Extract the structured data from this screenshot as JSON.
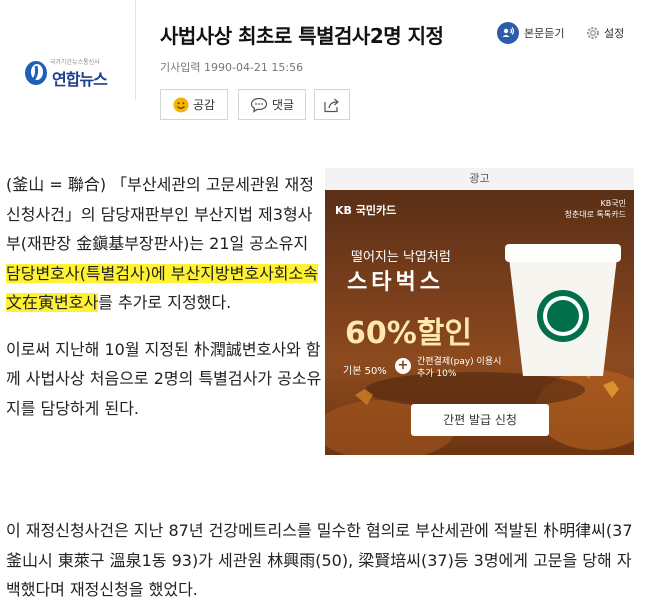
{
  "brand": {
    "logo_small": "국가기간뉴스통신사",
    "logo_text": "연합뉴스"
  },
  "article": {
    "title": "사법사상 최초로 특별검사2명 지정",
    "dateline": "기사입력 1990-04-21 15:56",
    "paragraphs": [
      {
        "pre": "(釜山 = 聯合) 「부산세관의 고문세관원 재정신청사건」의 담당재판부인 부산지법 제3형사부(재판장 金鎭基부장판사)는 21일 공소유지 ",
        "highlight": "담당변호사(특별검사)에 부산지방변호사회소속 文在寅변호사",
        "post": "를 추가로 지정했다."
      },
      {
        "text": "이로써 지난해 10월 지정된 朴潤誠변호사와 함께 사법사상 처음으로 2명의 특별검사가 공소유지를 담당하게 된다."
      },
      {
        "text": "이 재정신청사건은 지난 87년 건강메트리스를 밀수한 혐의로 부산세관에 적발된 朴明律씨(37 釜山시 東萊구 溫泉1동 93)가 세관원 林興雨(50), 梁賢培씨(37)등 3명에게 고문을 당해 자백했다며 재정신청을 했었다."
      }
    ]
  },
  "toolbar": {
    "listen_label": "본문듣기",
    "settings_label": "설정",
    "like_label": "공감",
    "comment_label": "댓글"
  },
  "ad": {
    "label": "광고",
    "kb_brand": "KB 국민카드",
    "kb_tagline_1": "KB국민",
    "kb_tagline_2": "청춘대로 톡톡카드",
    "line1": "떨어지는 낙엽처럼",
    "line2": "스타벅스",
    "discount": "60%할인",
    "base": "기본 50%",
    "extra_1": "간편결제(pay) 이용시",
    "extra_2": "추가 10%",
    "cta": "간편 발급 신청"
  },
  "colors": {
    "highlight": "#fff133",
    "brand_blue": "#1f3f8f",
    "listen_blue": "#2b5cab",
    "ad_brown": "#7a3f1c"
  }
}
